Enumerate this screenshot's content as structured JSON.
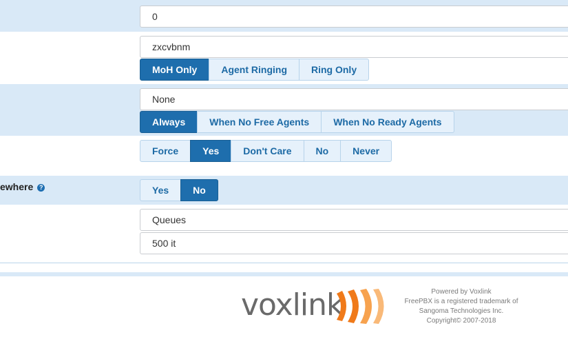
{
  "rows": {
    "r1": {
      "input_value": "0"
    },
    "r2": {
      "input_value": "zxcvbnm",
      "buttons": [
        "MoH Only",
        "Agent Ringing",
        "Ring Only"
      ],
      "active": "MoH Only"
    },
    "r3": {
      "input_value": "None",
      "buttons": [
        "Always",
        "When No Free Agents",
        "When No Ready Agents"
      ],
      "active": "Always"
    },
    "r4": {
      "buttons": [
        "Force",
        "Yes",
        "Don't Care",
        "No",
        "Never"
      ],
      "active": "Yes"
    },
    "r5": {
      "label": "ewhere",
      "help_icon": "?",
      "buttons": [
        "Yes",
        "No"
      ],
      "active": "No"
    },
    "r6": {
      "select_value": "Queues",
      "select_value_2": "500 it"
    }
  },
  "footer": {
    "logo_text": "voxlink",
    "lines": [
      "Powered by Voxlink",
      "FreePBX is a registered trademark of",
      "Sangoma Technologies Inc.",
      "Copyright© 2007-2018"
    ]
  },
  "colors": {
    "accent": "#1e6ead",
    "row_alt": "#d9e9f7",
    "logo_orange": "#f07a1a"
  }
}
